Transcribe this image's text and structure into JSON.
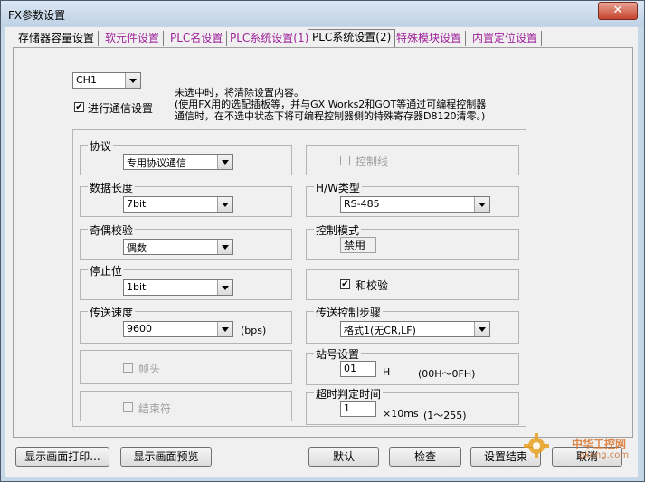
{
  "window": {
    "title": "FX参数设置",
    "close_label": "✕"
  },
  "tabs": [
    {
      "label": "存储器容量设置"
    },
    {
      "label": "软元件设置"
    },
    {
      "label": "PLC名设置"
    },
    {
      "label": "PLC系统设置(1)"
    },
    {
      "label": "PLC系统设置(2)"
    },
    {
      "label": "特殊模块设置"
    },
    {
      "label": "内置定位设置"
    }
  ],
  "channel": {
    "value": "CH1"
  },
  "comm": {
    "checked": "✔",
    "label": "进行通信设置"
  },
  "note": {
    "line1": "未选中时，将清除设置内容。",
    "line2": "(使用FX用的选配插板等，并与GX Works2和GOT等通过可编程控制器",
    "line3": "通信时，在不选中状态下将可编程控制器侧的特殊寄存器D8120清零。)"
  },
  "protocol": {
    "label": "协议",
    "value": "专用协议通信"
  },
  "data_length": {
    "label": "数据长度",
    "value": "7bit"
  },
  "parity": {
    "label": "奇偶校验",
    "value": "偶数"
  },
  "stop_bit": {
    "label": "停止位",
    "value": "1bit"
  },
  "baud": {
    "label": "传送速度",
    "value": "9600",
    "unit": "(bps)"
  },
  "header": {
    "label": "帧头"
  },
  "terminator": {
    "label": "结束符"
  },
  "control_line": {
    "label": "控制线"
  },
  "hw_type": {
    "label": "H/W类型",
    "value": "RS-485"
  },
  "control_mode": {
    "label": "控制模式",
    "value": "禁用"
  },
  "sum_check": {
    "checked": "✔",
    "label": "和校验"
  },
  "transfer_ctrl": {
    "label": "传送控制步骤",
    "value": "格式1(无CR,LF)"
  },
  "station": {
    "label": "站号设置",
    "value": "01",
    "suffix": "H",
    "range": "(00H～0FH)"
  },
  "timeout": {
    "label": "超时判定时间",
    "value": "1",
    "unit": "×10ms",
    "range": "(1～255)"
  },
  "buttons": {
    "print": "显示画面打印...",
    "preview": "显示画面预览",
    "default": "默认",
    "check": "检查",
    "finish": "设置结束",
    "cancel": "取消"
  },
  "watermark": {
    "text": "中华工控网",
    "url": "gkong.com"
  }
}
